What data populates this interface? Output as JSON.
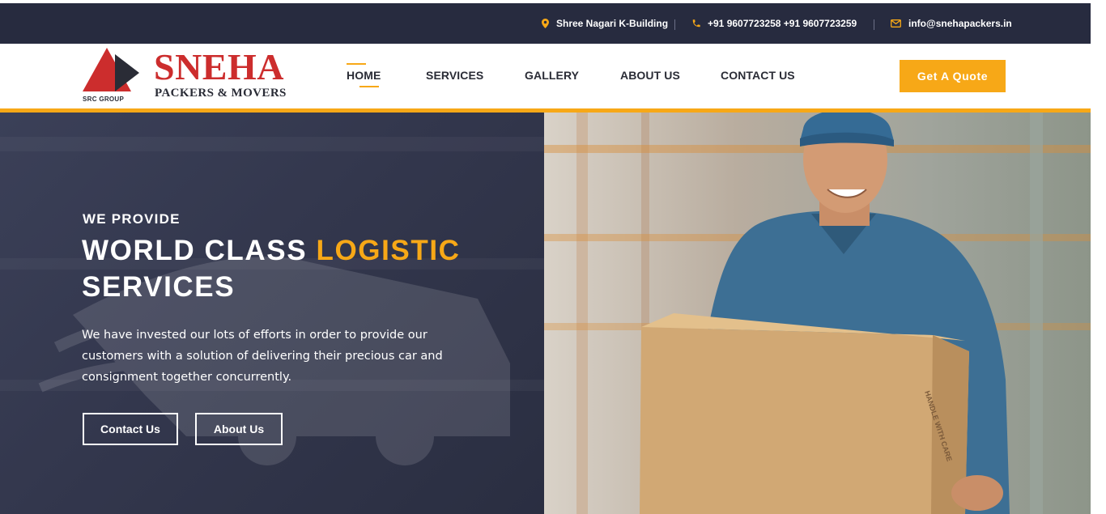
{
  "topbar": {
    "address": "Shree Nagari K-Building",
    "phone": "+91 9607723258 +91 9607723259",
    "email": "info@snehapackers.in",
    "address_icon": "map-pin-icon",
    "phone_icon": "phone-icon",
    "email_icon": "envelope-icon"
  },
  "brand": {
    "name": "SNEHA",
    "tagline": "PACKERS & MOVERS",
    "group": "SRC GROUP"
  },
  "nav": {
    "items": [
      "HOME",
      "SERVICES",
      "GALLERY",
      "ABOUT US",
      "CONTACT US"
    ],
    "active": "HOME",
    "cta": "Get A Quote"
  },
  "hero": {
    "eyebrow": "WE PROVIDE",
    "headline_part1": "WORLD CLASS ",
    "headline_highlight": "LOGISTIC",
    "headline_part2": "SERVICES",
    "description": "We have invested our lots of efforts in order to provide our customers with a solution of delivering their precious car and consignment together concurrently.",
    "primary_button": "Contact Us",
    "secondary_button": "About Us",
    "box_label": "HANDLE WITH CARE"
  },
  "colors": {
    "accent": "#f7a817",
    "dark": "#272b3f",
    "brand_red": "#cc2d2d"
  }
}
